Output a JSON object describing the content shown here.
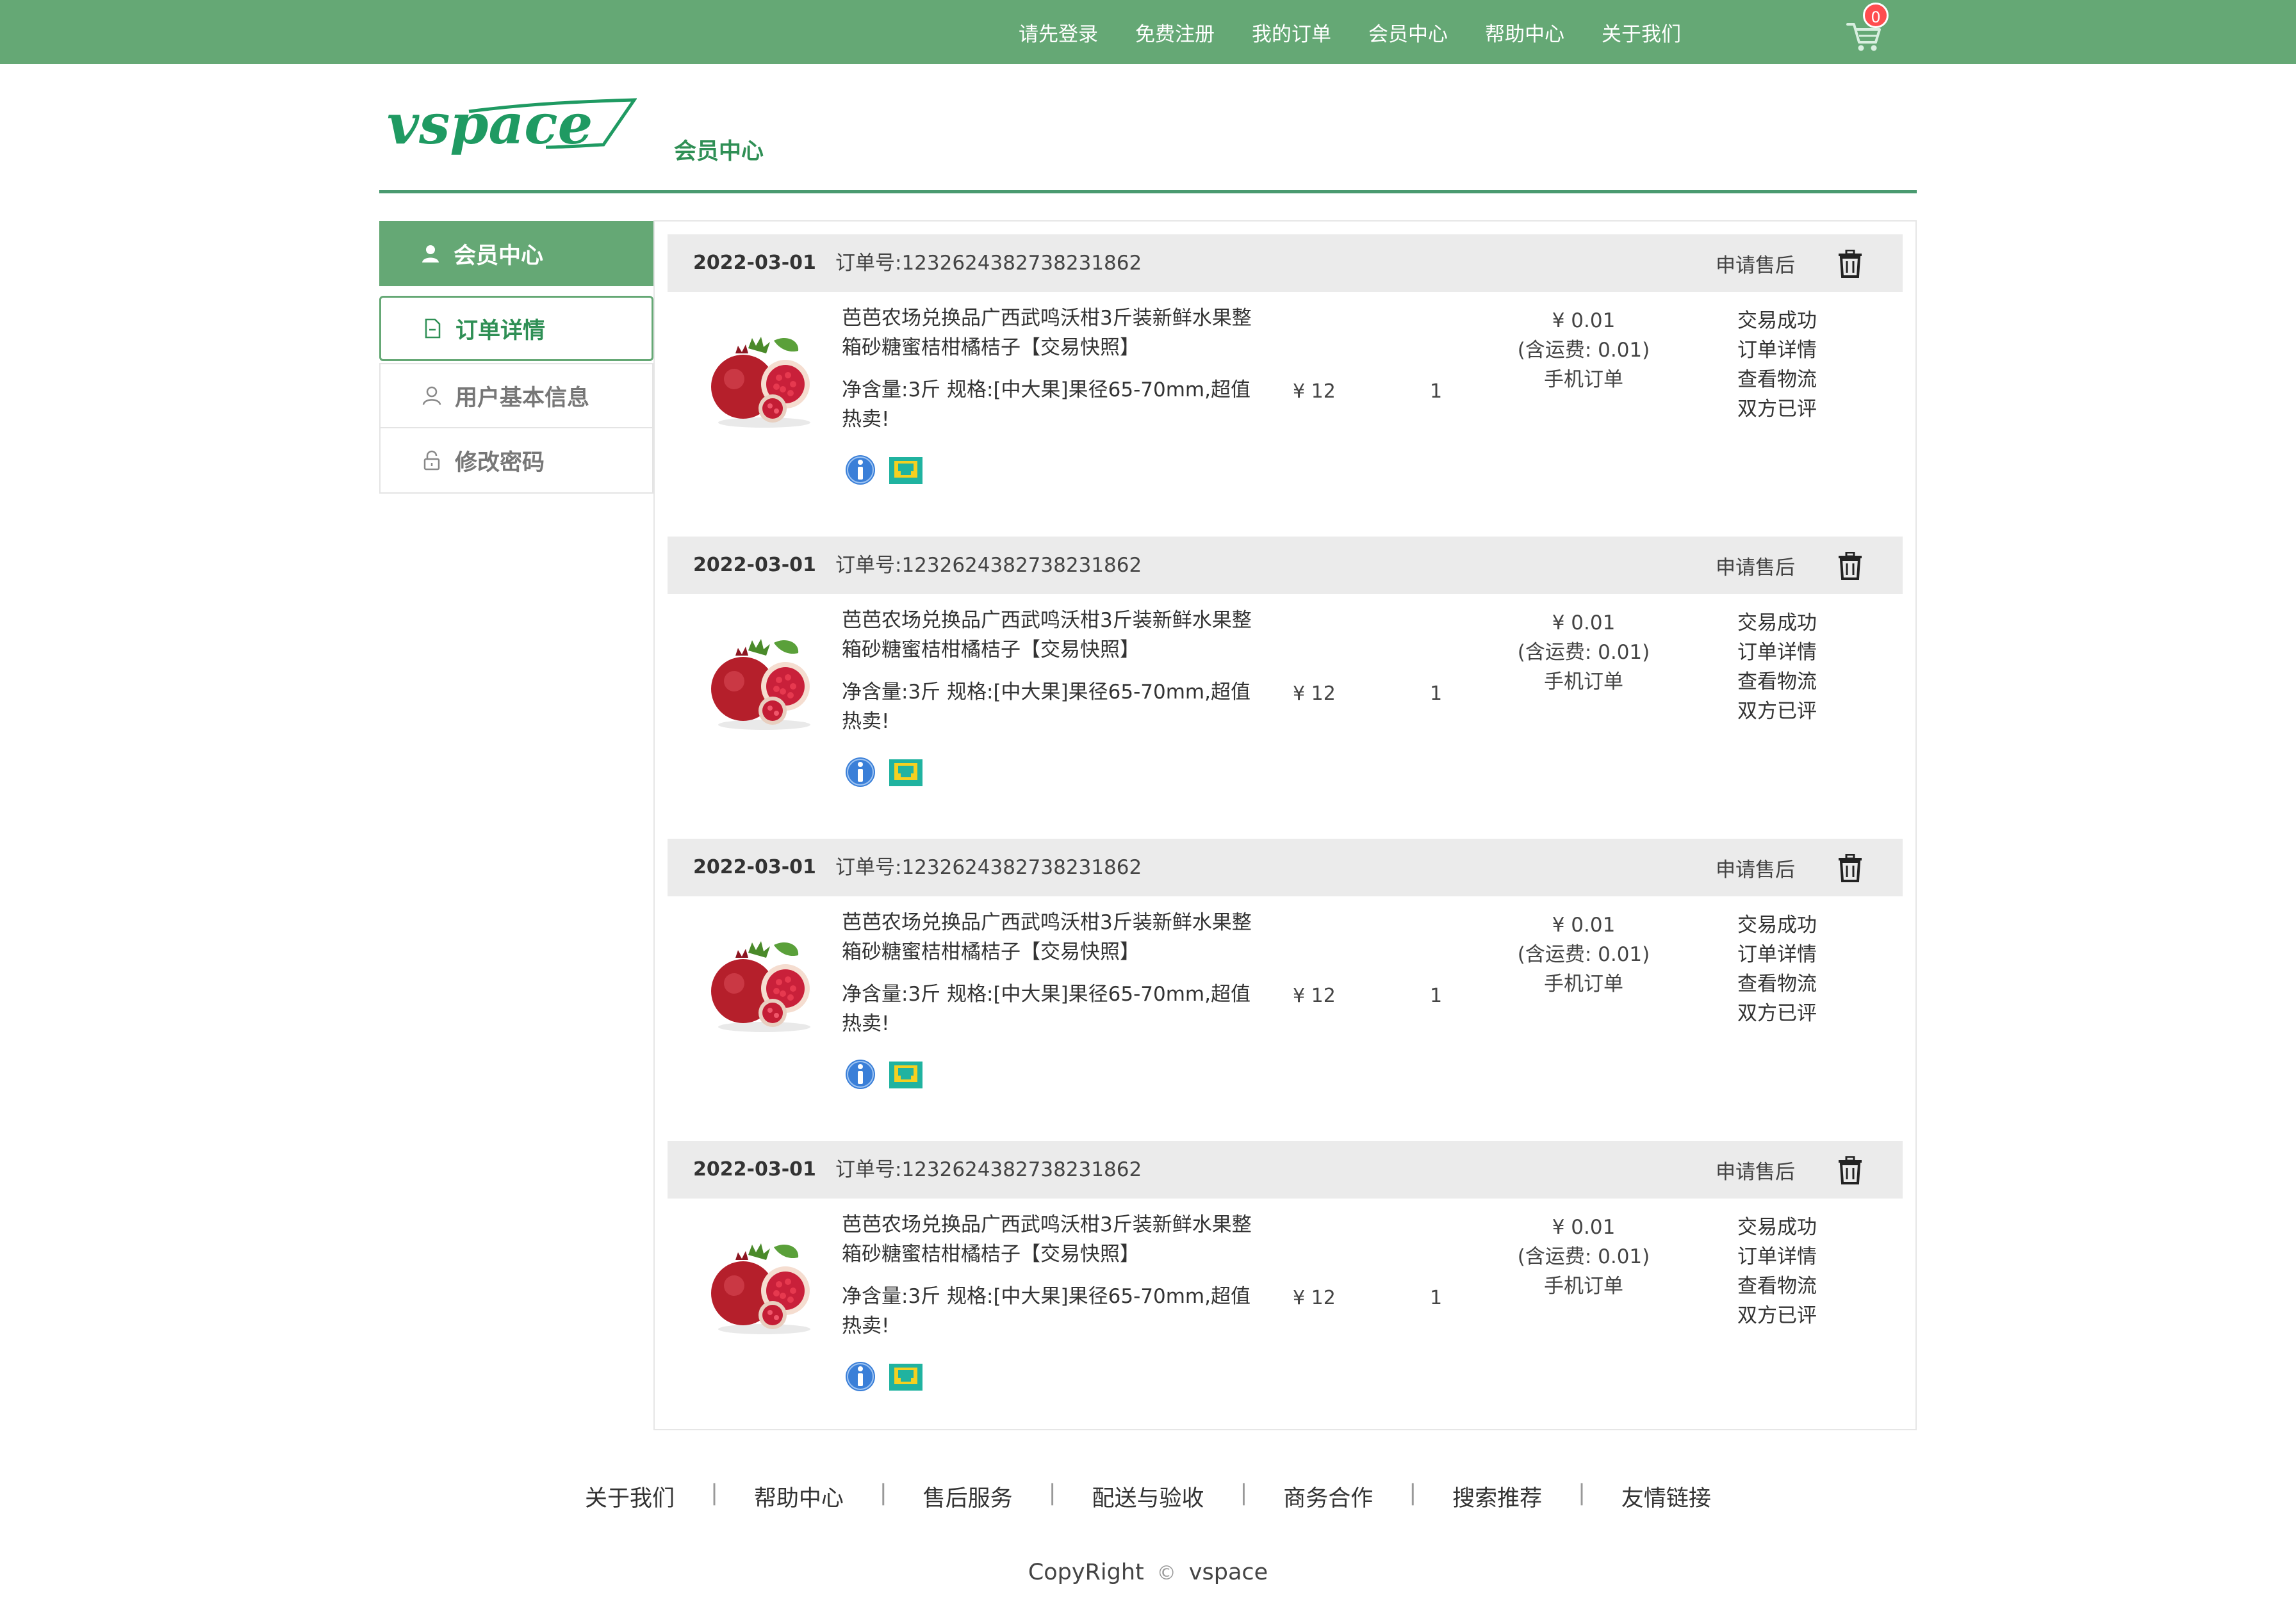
{
  "topnav": {
    "items": [
      "请先登录",
      "免费注册",
      "我的订单",
      "会员中心",
      "帮助中心",
      "关于我们"
    ],
    "cart_count": "0"
  },
  "header": {
    "logo_text": "vspace",
    "title": "会员中心"
  },
  "sidebar": {
    "items": [
      {
        "label": "会员中心",
        "icon": "user-icon"
      },
      {
        "label": "订单详情",
        "icon": "document-icon"
      },
      {
        "label": "用户基本信息",
        "icon": "person-outline-icon"
      },
      {
        "label": "修改密码",
        "icon": "lock-icon"
      }
    ]
  },
  "orders": [
    {
      "date": "2022-03-01",
      "order_no": "订单号:1232624382738231862",
      "after_sale": "申请售后",
      "name": "芭芭农场兑换品广西武鸣沃柑3斤装新鲜水果整箱砂糖蜜桔柑橘桔子【交易快照】",
      "spec": "净含量:3斤 规格:[中大果]果径65-70mm,超值热卖!",
      "price": "¥ 12",
      "qty": "1",
      "pay": [
        "¥ 0.01",
        "(含运费: 0.01)",
        "手机订单"
      ],
      "status": [
        "交易成功",
        "订单详情",
        "查看物流",
        "双方已评"
      ]
    },
    {
      "date": "2022-03-01",
      "order_no": "订单号:1232624382738231862",
      "after_sale": "申请售后",
      "name": "芭芭农场兑换品广西武鸣沃柑3斤装新鲜水果整箱砂糖蜜桔柑橘桔子【交易快照】",
      "spec": "净含量:3斤 规格:[中大果]果径65-70mm,超值热卖!",
      "price": "¥ 12",
      "qty": "1",
      "pay": [
        "¥ 0.01",
        "(含运费: 0.01)",
        "手机订单"
      ],
      "status": [
        "交易成功",
        "订单详情",
        "查看物流",
        "双方已评"
      ]
    },
    {
      "date": "2022-03-01",
      "order_no": "订单号:1232624382738231862",
      "after_sale": "申请售后",
      "name": "芭芭农场兑换品广西武鸣沃柑3斤装新鲜水果整箱砂糖蜜桔柑橘桔子【交易快照】",
      "spec": "净含量:3斤 规格:[中大果]果径65-70mm,超值热卖!",
      "price": "¥ 12",
      "qty": "1",
      "pay": [
        "¥ 0.01",
        "(含运费: 0.01)",
        "手机订单"
      ],
      "status": [
        "交易成功",
        "订单详情",
        "查看物流",
        "双方已评"
      ]
    },
    {
      "date": "2022-03-01",
      "order_no": "订单号:1232624382738231862",
      "after_sale": "申请售后",
      "name": "芭芭农场兑换品广西武鸣沃柑3斤装新鲜水果整箱砂糖蜜桔柑橘桔子【交易快照】",
      "spec": "净含量:3斤 规格:[中大果]果径65-70mm,超值热卖!",
      "price": "¥ 12",
      "qty": "1",
      "pay": [
        "¥ 0.01",
        "(含运费: 0.01)",
        "手机订单"
      ],
      "status": [
        "交易成功",
        "订单详情",
        "查看物流",
        "双方已评"
      ]
    }
  ],
  "footer": {
    "links": [
      "关于我们",
      "帮助中心",
      "售后服务",
      "配送与验收",
      "商务合作",
      "搜索推荐",
      "友情链接"
    ],
    "copyright_left": "CopyRight",
    "copyright_symbol": "©",
    "copyright_right": "vspace"
  },
  "colors": {
    "brand_green": "#65a875",
    "accent_green": "#2f8f55"
  }
}
